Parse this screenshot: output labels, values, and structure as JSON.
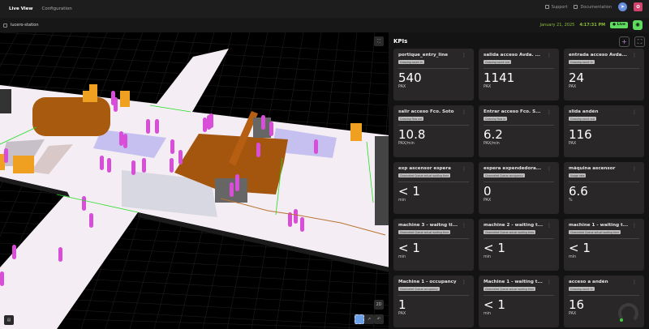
{
  "nav": {
    "tabs": [
      "Live View",
      "Configuration"
    ],
    "support": "Support",
    "documentation": "Documentation"
  },
  "subbar": {
    "station": "lucero-station",
    "date": "January 21, 2025",
    "time": "4:17:31 PM",
    "live": "Live"
  },
  "view": {
    "mode_2d": "2D"
  },
  "kpis": {
    "title": "KPIs",
    "cards": [
      {
        "title": "portique_entry_line",
        "tag": "Crossing count in",
        "value": "540",
        "unit": "PAX"
      },
      {
        "title": "salida acceso Avda. ...",
        "tag": "Crossing count out",
        "value": "1141",
        "unit": "PAX"
      },
      {
        "title": "entrada acceso Avda...",
        "tag": "Crossing count in",
        "value": "24",
        "unit": "PAX"
      },
      {
        "title": "salir acceso Fco. Soto",
        "tag": "Crossing flow out",
        "value": "10.8",
        "unit": "PAX/min"
      },
      {
        "title": "Entrar acceso Fco. S...",
        "tag": "Crossing flow in",
        "value": "6.2",
        "unit": "PAX/min"
      },
      {
        "title": "slida andén",
        "tag": "Crossing count out",
        "value": "116",
        "unit": "PAX"
      },
      {
        "title": "exp ascensor espera",
        "tag": "Channeled Queue actual waiting time",
        "value": "< 1",
        "unit": "min"
      },
      {
        "title": "espera expendedora...",
        "tag": "Channeled Queue occupancy",
        "value": "0",
        "unit": "PAX"
      },
      {
        "title": "máquina ascensor",
        "tag": "Usage rate",
        "value": "6.6",
        "unit": "%"
      },
      {
        "title": "machine 3 - waitng ti...",
        "tag": "Channeled Queue actual waiting time",
        "value": "< 1",
        "unit": "min"
      },
      {
        "title": "machine 2 - waiting t...",
        "tag": "Channeled Queue actual waiting time",
        "value": "< 1",
        "unit": "min"
      },
      {
        "title": "machine 1 - waiting t...",
        "tag": "Channeled Queue actual waiting time",
        "value": "< 1",
        "unit": "min"
      },
      {
        "title": "Machine 1 - occupancy",
        "tag": "Channeled Queue occupancy",
        "value": "1",
        "unit": "PAX"
      },
      {
        "title": "Machine 1 - waiting t...",
        "tag": "Channeled Queue actual waiting time",
        "value": "< 1",
        "unit": "min"
      },
      {
        "title": "acceso a andén",
        "tag": "Crossing count in",
        "value": "16",
        "unit": "PAX"
      }
    ]
  }
}
